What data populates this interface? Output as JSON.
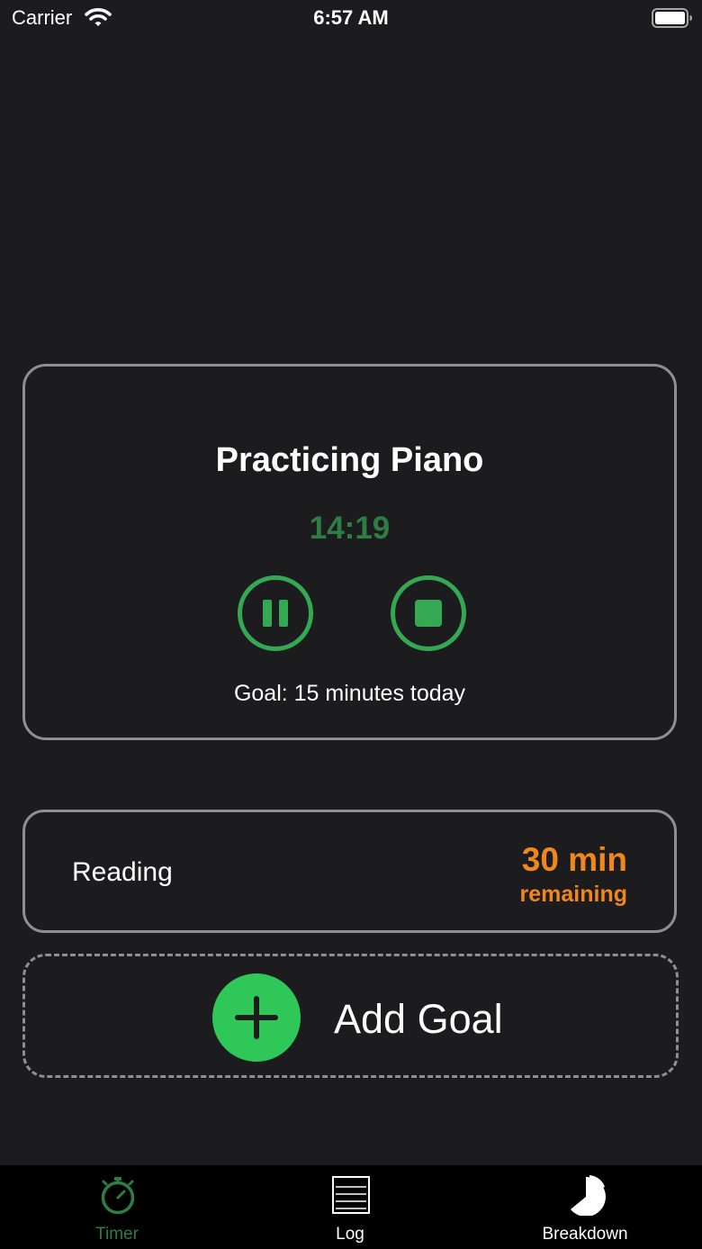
{
  "status_bar": {
    "carrier": "Carrier",
    "time": "6:57 AM"
  },
  "active_goal": {
    "title": "Practicing Piano",
    "elapsed": "14:19",
    "goal_text": "Goal: 15 minutes today",
    "pause_icon": "pause-icon",
    "stop_icon": "stop-icon"
  },
  "goals": [
    {
      "name": "Reading",
      "amount": "30 min",
      "suffix": "remaining"
    }
  ],
  "add_goal": {
    "label": "Add Goal",
    "icon": "plus-icon"
  },
  "tabs": [
    {
      "label": "Timer",
      "icon": "stopwatch-icon",
      "selected": true
    },
    {
      "label": "Log",
      "icon": "list-icon",
      "selected": false
    },
    {
      "label": "Breakdown",
      "icon": "pie-chart-icon",
      "selected": false
    }
  ],
  "colors": {
    "background": "#1c1c1e",
    "card_border": "#8e8e93",
    "timer_green": "#2e7d45",
    "control_green": "#34a853",
    "remaining_orange": "#f0871e",
    "add_green": "#30c759",
    "tab_active": "#2e7d45",
    "tab_inactive": "#ffffff",
    "tab_bar": "#000000"
  }
}
